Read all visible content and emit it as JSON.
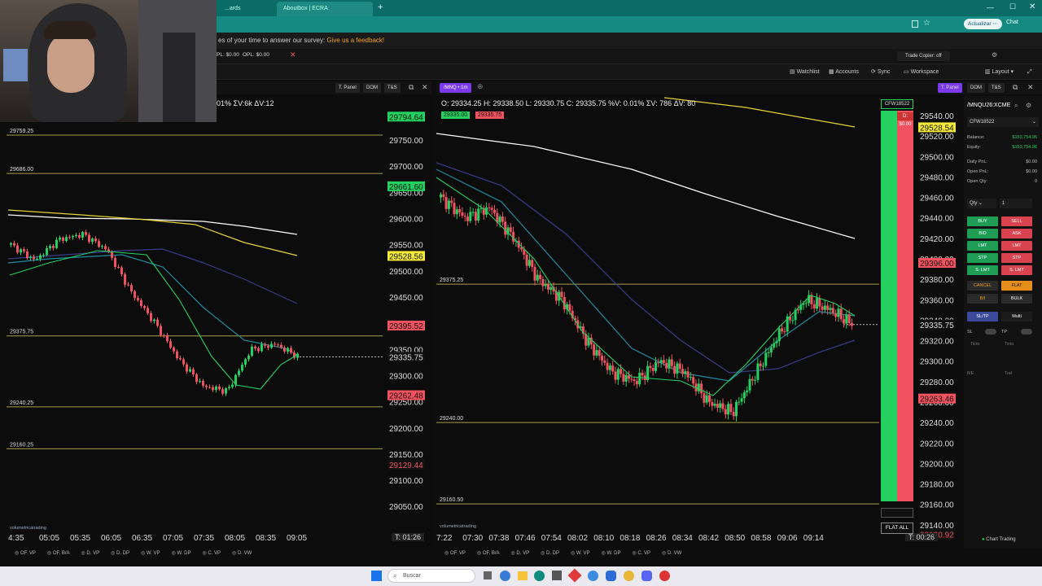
{
  "browser": {
    "tabs": [
      "...ards",
      "Aboutbox | ECRA"
    ],
    "buttons": {
      "update": "Actualizar",
      "chat": "Chat"
    }
  },
  "survey": {
    "text": "es of your time to answer our survey:",
    "link": "Give us a feedback!"
  },
  "appbar": {
    "pl": "PL: $0.00",
    "opl": "OPL: $0.00",
    "trade_copier": "Trade Copier: off"
  },
  "nav": {
    "watchlist": "Watchlist",
    "accounts": "Accounts",
    "sync": "Sync",
    "workspace": "Workspace",
    "layout": "Layout"
  },
  "left_chart": {
    "buttons": [
      "T. Panel",
      "DOM",
      "T&S"
    ],
    "stats": "01% ΣV:6k ΔV:12",
    "price_labels": [
      "29750.00",
      "29700.00",
      "29650.00",
      "29600.00",
      "29550.00",
      "29500.00",
      "29450.00",
      "29400.00",
      "29350.00",
      "29300.00",
      "29250.00",
      "29200.00",
      "29150.00",
      "29100.00",
      "29050.00"
    ],
    "tags": {
      "top": "29794.64",
      "green": "29661.60",
      "yellow": "29528.56",
      "red1": "29395.52",
      "current": "29335.75",
      "red2": "29262.48",
      "red3": "29129.44"
    },
    "levels": [
      "29759.25",
      "29686.00",
      "29375.75",
      "29240.25",
      "29160.25"
    ],
    "times": [
      "4:35",
      "05:05",
      "05:35",
      "06:05",
      "06:35",
      "07:05",
      "07:35",
      "08:05",
      "08:35",
      "09:05"
    ],
    "timer": "T: 01:26",
    "bottom_tabs": [
      "OF. VP",
      "OF. B/A",
      "D. VP",
      "D. DP",
      "W. VP",
      "W. DP",
      "C. VP",
      "D. VW"
    ],
    "brand": "volumetricatrading"
  },
  "right_chart": {
    "symbol": "/MNQ",
    "tf": "1m",
    "buttons": [
      "T. Panel",
      "DOM",
      "T&S"
    ],
    "ohlc": "O: 29334.25  H: 29338.50  L: 29330.75  C: 29335.75  %V: 0.01%  ΣV: 786  ΔV: 80",
    "bid": "29335.00",
    "ask": "29335.75",
    "account_tag": "CFW18522",
    "pnl_tag": "D: $0.00",
    "flat_all": "FLAT ALL",
    "price_labels": [
      "29540.00",
      "29520.00",
      "29500.00",
      "29480.00",
      "29460.00",
      "29440.00",
      "29420.00",
      "29400.00",
      "29380.00",
      "29360.00",
      "29340.00",
      "29320.00",
      "29300.00",
      "29280.00",
      "29260.00",
      "29240.00",
      "29220.00",
      "29200.00",
      "29180.00",
      "29160.00",
      "29140.00"
    ],
    "tags": {
      "yellow": "29528.54",
      "red1": "29396.00",
      "current": "29335.75",
      "red2": "29263.46",
      "red3": "29130.92"
    },
    "levels": [
      "29375.25",
      "29240.00",
      "29160.50"
    ],
    "times": [
      "7:22",
      "07:30",
      "07:38",
      "07:46",
      "07:54",
      "08:02",
      "08:10",
      "08:18",
      "08:26",
      "08:34",
      "08:42",
      "08:50",
      "08:58",
      "09:06",
      "09:14"
    ],
    "timer": "T: 00:26",
    "bottom_tabs": [
      "OF. VP",
      "OF. B/A",
      "D. VP",
      "D. DP",
      "W. VP",
      "W. DP",
      "C. VP",
      "D. VW"
    ],
    "brand": "volumetricatrading"
  },
  "panel": {
    "symbol": "/MNQU26:XCME",
    "account": "CFW18522",
    "rows": [
      {
        "label": "Balance:",
        "value": "$153,754.96"
      },
      {
        "label": "Equity:",
        "value": "$153,754.96"
      },
      {
        "label": "Daily PnL:",
        "value": "$0.00"
      },
      {
        "label": "Open PnL:",
        "value": "$0.00"
      },
      {
        "label": "Open Qty:",
        "value": "0"
      }
    ],
    "qty_label": "Qty",
    "qty_value": "1",
    "buy": "BUY",
    "sell": "SELL",
    "bid": "BID",
    "ask": "ASK",
    "lmt": "LMT",
    "stp": "STP",
    "slmt": "S. LMT",
    "cancel": "CANCEL",
    "flat": "FLAT",
    "bi": "B/I",
    "bulk": "BULK",
    "sltp": "SL/TP",
    "multi": "Multi",
    "sl": "SL",
    "tp": "TP",
    "ticks": "Ticks",
    "be": "B/E",
    "trail": "Trail",
    "chart_trading": "Chart Trading"
  },
  "taskbar": {
    "search": "Buscar"
  },
  "colors": {
    "up": "#24d160",
    "down": "#f1525f",
    "level": "#a5a044",
    "accent": "#7c3aed"
  }
}
